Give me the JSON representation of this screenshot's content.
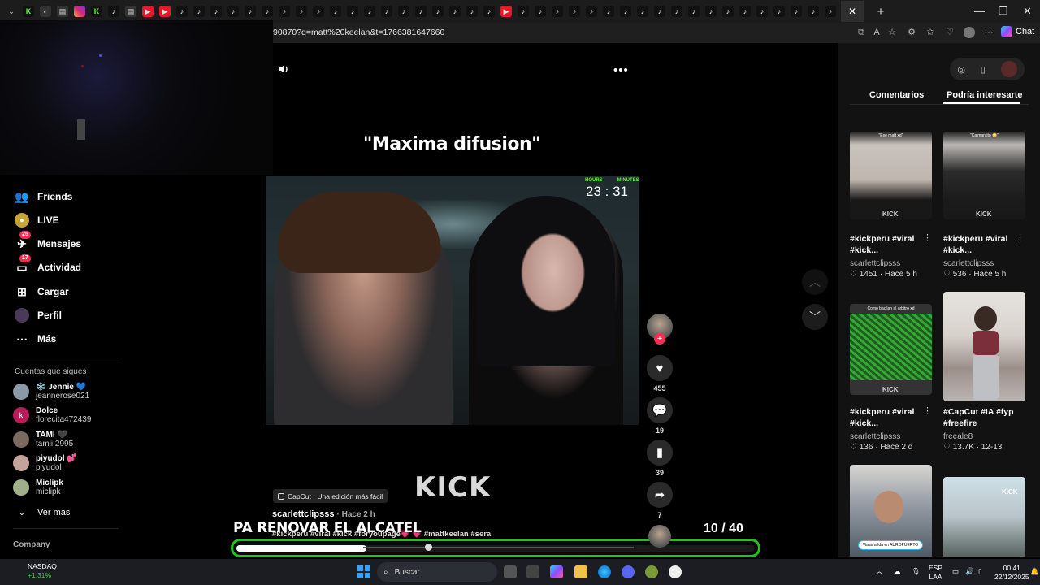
{
  "browser": {
    "url": "90870?q=matt%20keelan&t=1766381647660",
    "chat_label": "Chat",
    "tab_close": "✕",
    "new_tab": "+"
  },
  "sidebar": {
    "items": [
      {
        "label": "Friends",
        "icon": "friends-icon"
      },
      {
        "label": "LIVE",
        "icon": "live-icon"
      },
      {
        "label": "Mensajes",
        "icon": "messages-icon",
        "badge": "25"
      },
      {
        "label": "Actividad",
        "icon": "activity-icon",
        "badge": "17"
      },
      {
        "label": "Cargar",
        "icon": "upload-icon"
      },
      {
        "label": "Perfil",
        "icon": "profile-icon"
      },
      {
        "label": "Más",
        "icon": "more-icon"
      }
    ],
    "following_title": "Cuentas que sigues",
    "following": [
      {
        "name": "❄️ Jennie 💙",
        "user": "jeannerose021",
        "initial": ""
      },
      {
        "name": "Dolce",
        "user": "florecita472439",
        "initial": "k"
      },
      {
        "name": "TAMI 🖤",
        "user": "tamii.2995",
        "initial": ""
      },
      {
        "name": "piyudol 💕",
        "user": "piyudol",
        "initial": ""
      },
      {
        "name": "Miclipk",
        "user": "miclipk",
        "initial": ""
      }
    ],
    "see_more": "Ver más",
    "company": "Company"
  },
  "video": {
    "headline": "\"Maxima difusion\"",
    "timer_hours_label": "HOURS",
    "timer_minutes_label": "MINUTES",
    "timer_value": "23 :  31",
    "watermark": "KICK",
    "capcut": "CapCut · Una edición más fácil",
    "author": "scarlettclipsss",
    "time_ago": "· Hace 2 h",
    "description": "#kickperu #viral #kick #foryoupage💗 💗 #mattkeelan #sera",
    "caption_overlay": "PA RENOVAR EL ALCATEL",
    "counter": "10  / 40",
    "progress": 0.25,
    "scrub": 0.24
  },
  "actions": {
    "likes": "455",
    "comments": "19",
    "saves": "39",
    "shares": "7"
  },
  "right_panel": {
    "tabs": [
      "Comentarios",
      "Podría interesarte"
    ],
    "cards": [
      {
        "title": "#kickperu #viral #kick...",
        "user": "scarlettclipsss",
        "meta": "♡ 1451 · Hace 5 h",
        "caption": "\"Ese matt xd\""
      },
      {
        "title": "#kickperu #viral #kick...",
        "user": "scarlettclipsss",
        "meta": "♡ 536 · Hace 5 h",
        "caption": "\"Calmantito 😳\""
      },
      {
        "title": "#kickperu #viral #kick...",
        "user": "scarlettclipsss",
        "meta": "♡ 136 · Hace 2 d",
        "caption": "Como bacilan al arbitro xd"
      },
      {
        "title": "#CapCut #IA #fyp #freefire",
        "user": "freeale8",
        "meta": "♡ 13.7K · 12-13",
        "caption": ""
      },
      {
        "caption": "Viajar a Ida en AUROPUERTO"
      },
      {
        "caption": ""
      }
    ],
    "kick_label": "KICK"
  },
  "taskbar": {
    "stock_name": "NASDAQ",
    "stock_change": "+1.31%",
    "search_placeholder": "Buscar",
    "lang_1": "ESP",
    "lang_2": "LAA",
    "time": "00:41",
    "date": "22/12/2025"
  }
}
